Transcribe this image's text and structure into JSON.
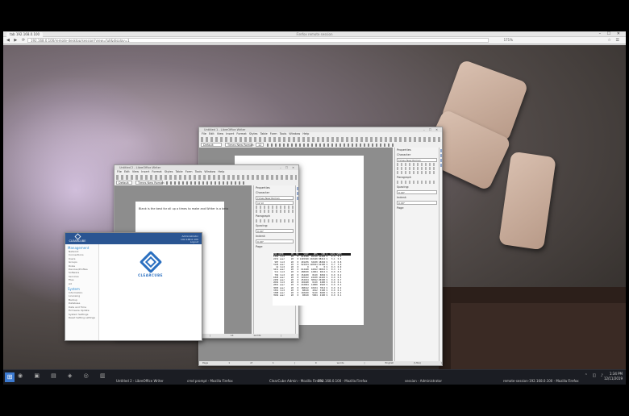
{
  "browser": {
    "window_title": "Firefox remote session",
    "tab_label": "tab 192.168.0.100",
    "url": "192.168.0.100/remote-desktop/session?view=full&display=1",
    "zoom": "171%",
    "nav_icons": "◀ ▶ ⟳",
    "window_controls": "– ☐ ✕",
    "menu_icons": "☆ ☰"
  },
  "writer_big": {
    "title": "Untitled 1 - LibreOffice Writer",
    "menu": "File Edit View Insert Format Styles Table Form Tools Window Help",
    "style_box": "Default",
    "font_box": "Times New Roman",
    "size_box": "12",
    "status": "Page 1 of 1 | 0 words | English (USA) | 100%"
  },
  "writer_small": {
    "title": "Untitled 2 - LibreOffice Writer",
    "menu": "File Edit View Insert Format Styles Table Form Tools Window Help",
    "style_box": "Default",
    "font_box": "Times New Roman",
    "doc_line": "Blank is the best for all up a times to make and Writer is a beta",
    "status": "Page 1 of 1 | 14 words | English (USA)"
  },
  "properties": {
    "heading": "Properties",
    "sections": [
      "Character",
      "Paragraph",
      "Page"
    ],
    "font": "Times New Roman",
    "size": "12 pt",
    "spacing_label": "Spacing:",
    "indent_label": "Indent:",
    "val_a": "0.00\"",
    "val_b": "0.00\""
  },
  "sheet": {
    "rows": [
      "PID USER      PR  NI    VIRT    RES   SHR S  %CPU %MEM",
      "1204 root     20   0  812340  95120 41220 S   4.3  2.4",
      "2231 user     20   0 1245320 210448 88412 S   3.1  5.3",
      " 987 root     20   0  401236  32108 18204 S   1.0  0.8",
      "3120 user     20   0  922104 120944 62100 S   0.7  3.0",
      "  12 root     20   0       0      0     0 S   0.3  0.0",
      "3411 user     20   0  612448  44812 30016 S   0.3  1.1",
      " 511 root     20   0  288100  12004  9012 S   0.0  0.3",
      " 702 root     20   0  154220   8120  6004 S   0.0  0.2",
      "1820 user     20   0  320412  22108 14220 S   0.0  0.5",
      "2450 user     20   0  452104  30012 20100 S   0.0  0.7",
      "2602 root     20   0  102448   6120  4400 S   0.0  0.1",
      "2891 user     20   0  210004  14808  9920 S   0.0  0.3",
      "3005 user     20   0  188412  10104  7812 S   0.0  0.2",
      "3301 root     20   0   88120   4012  3100 S   0.0  0.1",
      "3388 user     20   0  140220   9120  6600 S   0.0  0.2",
      "3502 user     20   0   98120   5004  4100 S   0.0  0.1"
    ]
  },
  "clearcube": {
    "logo_text": "CLEARCUBE",
    "header_info": [
      "Administrator",
      "192.168.0.100",
      "Logout"
    ],
    "brand": "CLEARCUBE",
    "sections": [
      {
        "title": "Management",
        "items": [
          "Network",
          "Connections",
          "Users",
          "Groups",
          "Roles",
          "Devices/Profiles",
          "Software",
          "Services",
          "Files",
          "Ad"
        ]
      },
      {
        "title": "System",
        "items": [
          "Information",
          "Licensing",
          "Backup",
          "Database",
          "Date and Time",
          "Firmware Update",
          "System Settings",
          "Reset Setting settings"
        ]
      }
    ]
  },
  "taskbar": {
    "start_icon": "windows-start",
    "pinned_icons": "◉ ▣ ▤ ◈ ◎ ▥",
    "items": [
      "Untitled 2 - LibreOffice Writer",
      "cmd prompt - Mozilla Firefox",
      "ClearCube Admin - Mozilla Firefox",
      "192.168.0.100 - Mozilla Firefox",
      "session - Administrator",
      "remote-session-192.168.0.100 - Mozilla Firefox"
    ],
    "tray": "⌃ ◫ ♪",
    "time": "1:34 PM",
    "date": "12/11/2019"
  }
}
